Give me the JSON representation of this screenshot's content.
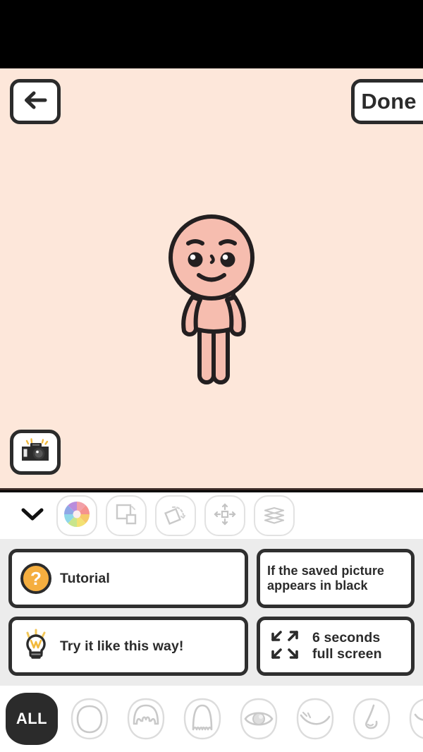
{
  "app": {
    "canvas_bg": "#FDE7DA",
    "panel_bg": "#ECECEC",
    "ink": "#2b2b2b",
    "accent_orange": "#F5AE3F"
  },
  "topbar": {
    "back_icon": "arrow-left-icon",
    "done_label": "Done"
  },
  "canvas": {
    "camera_icon": "camera-icon",
    "avatar_name": "avatar-character"
  },
  "toolbar": {
    "collapse_icon": "chevron-down-icon",
    "tools": [
      {
        "name": "color-wheel-icon",
        "label": "Color",
        "active": true
      },
      {
        "name": "duplicate-icon",
        "label": "Duplicate",
        "active": false
      },
      {
        "name": "rotate-icon",
        "label": "Rotate",
        "active": false
      },
      {
        "name": "move-icon",
        "label": "Move",
        "active": false
      },
      {
        "name": "layers-icon",
        "label": "Layers",
        "active": false
      }
    ]
  },
  "help_cards": [
    {
      "id": "tutorial",
      "icon": "question-mark-icon",
      "text": "Tutorial"
    },
    {
      "id": "saved-black",
      "icon": "none",
      "text": "If the saved picture appears in black"
    },
    {
      "id": "try-this-way",
      "icon": "lightbulb-icon",
      "text": "Try it like this way!"
    },
    {
      "id": "fullscreen-6s",
      "icon": "expand-arrows-icon",
      "text": "6 seconds\nfull screen"
    }
  ],
  "categories": [
    {
      "id": "all",
      "label": "ALL",
      "icon": "all-label",
      "selected": true
    },
    {
      "id": "face",
      "label": "",
      "icon": "face-shape-icon",
      "selected": false
    },
    {
      "id": "hair-front",
      "label": "",
      "icon": "hair-bangs-icon",
      "selected": false
    },
    {
      "id": "hair-long",
      "label": "",
      "icon": "hair-long-icon",
      "selected": false
    },
    {
      "id": "eyes",
      "label": "",
      "icon": "eye-icon",
      "selected": false
    },
    {
      "id": "eyebrows",
      "label": "",
      "icon": "eyebrow-icon",
      "selected": false
    },
    {
      "id": "nose",
      "label": "",
      "icon": "nose-icon",
      "selected": false
    },
    {
      "id": "mouth",
      "label": "",
      "icon": "mouth-icon",
      "selected": false
    },
    {
      "id": "ear",
      "label": "",
      "icon": "ear-icon",
      "selected": false
    }
  ]
}
